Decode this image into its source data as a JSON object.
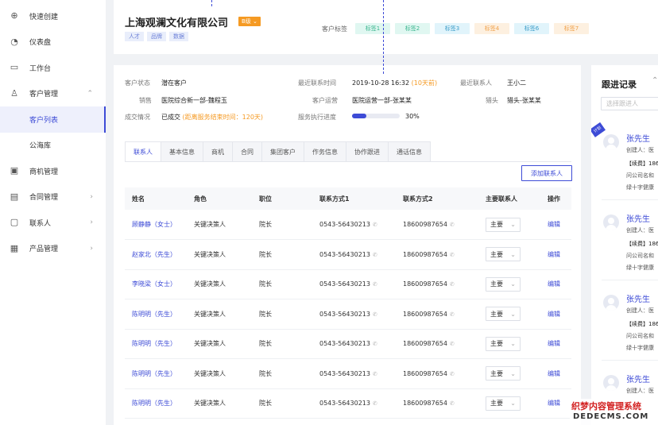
{
  "sidebar": {
    "items": [
      {
        "label": "快速创建",
        "icon": "plus-circle-icon",
        "glyph": "⊕"
      },
      {
        "label": "仪表盘",
        "icon": "dashboard-icon",
        "glyph": "◔"
      },
      {
        "label": "工作台",
        "icon": "monitor-icon",
        "glyph": "▭"
      },
      {
        "label": "客户管理",
        "icon": "customer-icon",
        "glyph": "♙"
      },
      {
        "label": "客户列表"
      },
      {
        "label": "公海库"
      },
      {
        "label": "商机管理",
        "icon": "briefcase-icon",
        "glyph": "▣"
      },
      {
        "label": "合同管理",
        "icon": "contract-icon",
        "glyph": "▤"
      },
      {
        "label": "联系人",
        "icon": "contact-icon",
        "glyph": "▢"
      },
      {
        "label": "产品管理",
        "icon": "product-icon",
        "glyph": "▦"
      }
    ]
  },
  "header": {
    "company": "上海观澜文化有限公司",
    "level": "B级",
    "tags": [
      "人才",
      "品牌",
      "数据"
    ],
    "customer_tags_label": "客户标签",
    "customer_tags": [
      {
        "text": "标签1",
        "bg": "#e0f7f1",
        "fg": "#3ab58e"
      },
      {
        "text": "标签2",
        "bg": "#e0f7f1",
        "fg": "#3ab58e"
      },
      {
        "text": "标签3",
        "bg": "#e1f4fb",
        "fg": "#3a9cc8"
      },
      {
        "text": "标签4",
        "bg": "#fdf0e0",
        "fg": "#f0a14a"
      },
      {
        "text": "标签6",
        "bg": "#e1f4fb",
        "fg": "#3a9cc8"
      },
      {
        "text": "标签7",
        "bg": "#fdf0e0",
        "fg": "#f0a14a"
      }
    ]
  },
  "info": {
    "status_label": "客户状态",
    "status": "潜在客户",
    "last_contact_time_label": "最近联系时间",
    "last_contact_time": "2019-10-28 16:32",
    "last_contact_ago": "(10天前)",
    "last_contact_person_label": "最近联系人",
    "last_contact_person": "王小二",
    "sales_label": "销售",
    "sales": "医院综合新一部-魏程玉",
    "ops_label": "客户运营",
    "ops": "医院运营一部-张某某",
    "head_label": "猎头",
    "head": "猎头-张某某",
    "deal_label": "成交情况",
    "deal": "已成交",
    "deal_note": "(距离服务结束时间：120天)",
    "progress_label": "服务执行进度",
    "progress_value": 30,
    "progress_text": "30%"
  },
  "tabs": [
    "联系人",
    "基本信息",
    "商机",
    "合同",
    "集团客户",
    "作务信息",
    "协作跟进",
    "通话信息"
  ],
  "add_contact_label": "添加联系人",
  "table": {
    "headers": [
      "姓名",
      "角色",
      "职位",
      "联系方式1",
      "联系方式2",
      "主要联系人",
      "操作"
    ],
    "rows": [
      {
        "name": "顾静静（女士）",
        "role": "关键决策人",
        "title": "院长",
        "phone1": "0543-56430213",
        "phone2": "18600987654",
        "main": "主要",
        "op": "编辑"
      },
      {
        "name": "赵家北（先生）",
        "role": "关键决策人",
        "title": "院长",
        "phone1": "0543-56430213",
        "phone2": "18600987654",
        "main": "主要",
        "op": "编辑"
      },
      {
        "name": "李晓梁（女士）",
        "role": "关键决策人",
        "title": "院长",
        "phone1": "0543-56430213",
        "phone2": "18600987654",
        "main": "主要",
        "op": "编辑"
      },
      {
        "name": "陈明明（先生）",
        "role": "关键决策人",
        "title": "院长",
        "phone1": "0543-56430213",
        "phone2": "18600987654",
        "main": "主要",
        "op": "编辑"
      },
      {
        "name": "陈明明（先生）",
        "role": "关键决策人",
        "title": "院长",
        "phone1": "0543-56430213",
        "phone2": "18600987654",
        "main": "主要",
        "op": "编辑"
      },
      {
        "name": "陈明明（先生）",
        "role": "关键决策人",
        "title": "院长",
        "phone1": "0543-56430213",
        "phone2": "18600987654",
        "main": "主要",
        "op": "编辑"
      },
      {
        "name": "陈明明（先生）",
        "role": "关键决策人",
        "title": "院长",
        "phone1": "0543-56430213",
        "phone2": "18600987654",
        "main": "主要",
        "op": "编辑"
      }
    ]
  },
  "follow": {
    "title": "跟进记录",
    "search_placeholder": "选择跟进人",
    "corner_tag": "计划",
    "cards": [
      {
        "name": "张先生",
        "l1": "创建人：医",
        "l2": "【续费】186",
        "l3": "问公司名和",
        "l4": "绿十字健康"
      },
      {
        "name": "张先生",
        "l1": "创建人：医",
        "l2": "【续费】186",
        "l3": "问公司名和",
        "l4": "绿十字健康"
      },
      {
        "name": "张先生",
        "l1": "创建人：医",
        "l2": "【续费】186",
        "l3": "问公司名和",
        "l4": "绿十字健康"
      },
      {
        "name": "张先生",
        "l1": "创建人：医",
        "l2": "",
        "l3": "",
        "l4": ""
      }
    ]
  },
  "watermark": {
    "line1": "织梦内容管理系统",
    "line2": "DEDECMS.COM"
  }
}
